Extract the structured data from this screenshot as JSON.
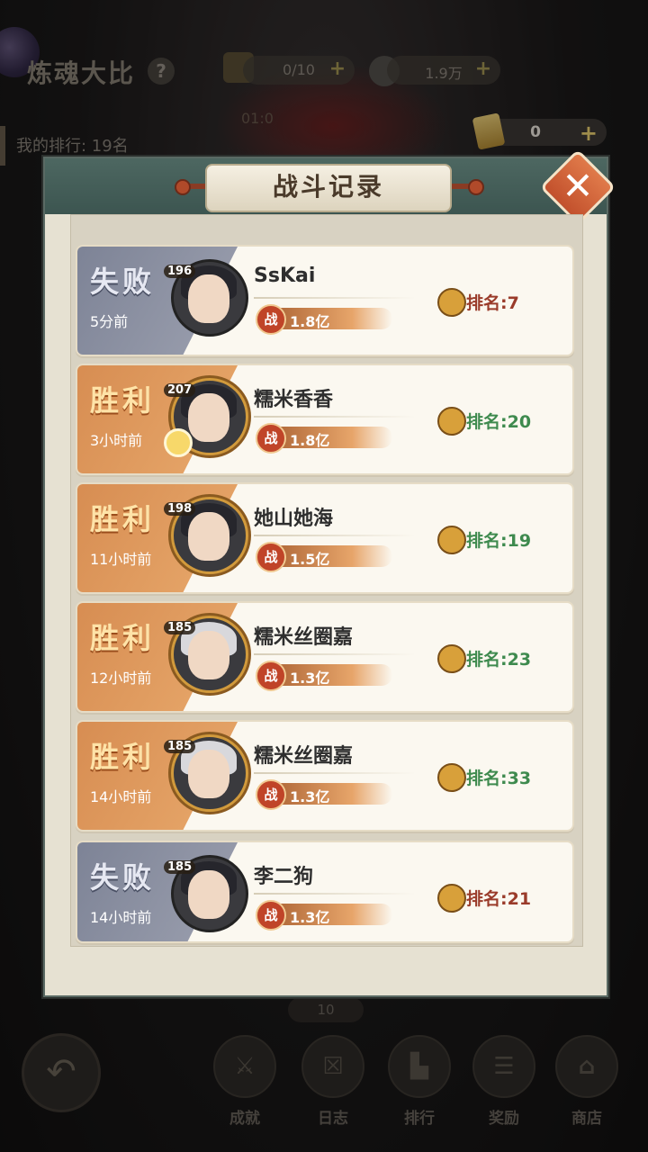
{
  "background": {
    "title": "炼魂大比",
    "help_label": "?",
    "resource1": "0/10",
    "resource2": "1.9万",
    "plus": "+",
    "my_rank": "我的排行: 19名",
    "tickets": "0",
    "timer": "01:0",
    "bottom_badge": "10",
    "back_label": "↶",
    "nav": [
      {
        "label": "成就",
        "glyph": "⚔"
      },
      {
        "label": "日志",
        "glyph": "☒"
      },
      {
        "label": "排行",
        "glyph": "▙"
      },
      {
        "label": "奖励",
        "glyph": "☰"
      },
      {
        "label": "商店",
        "glyph": "⌂"
      }
    ]
  },
  "modal": {
    "title": "战斗记录",
    "close_glyph": "✕"
  },
  "records": [
    {
      "result": "失败",
      "time": "5分前",
      "level": "196",
      "name": "SsKai",
      "power": "1.8亿",
      "rank": "排名:7"
    },
    {
      "result": "胜利",
      "time": "3小时前",
      "level": "207",
      "name": "糯米香香",
      "power": "1.8亿",
      "rank": "排名:20"
    },
    {
      "result": "胜利",
      "time": "11小时前",
      "level": "198",
      "name": "她山她海",
      "power": "1.5亿",
      "rank": "排名:19"
    },
    {
      "result": "胜利",
      "time": "12小时前",
      "level": "185",
      "name": "糯米丝圈嘉",
      "power": "1.3亿",
      "rank": "排名:23"
    },
    {
      "result": "胜利",
      "time": "14小时前",
      "level": "185",
      "name": "糯米丝圈嘉",
      "power": "1.3亿",
      "rank": "排名:33"
    },
    {
      "result": "失败",
      "time": "14小时前",
      "level": "185",
      "name": "李二狗",
      "power": "1.3亿",
      "rank": "排名:21"
    }
  ],
  "power_icon_label": "战",
  "colors": {
    "lose_panel": "#8a8fa0",
    "win_panel": "#df9b5e",
    "lose_rank": "#9a3b2a",
    "win_rank": "#3e8a4e",
    "modal_header": "#45605a"
  }
}
